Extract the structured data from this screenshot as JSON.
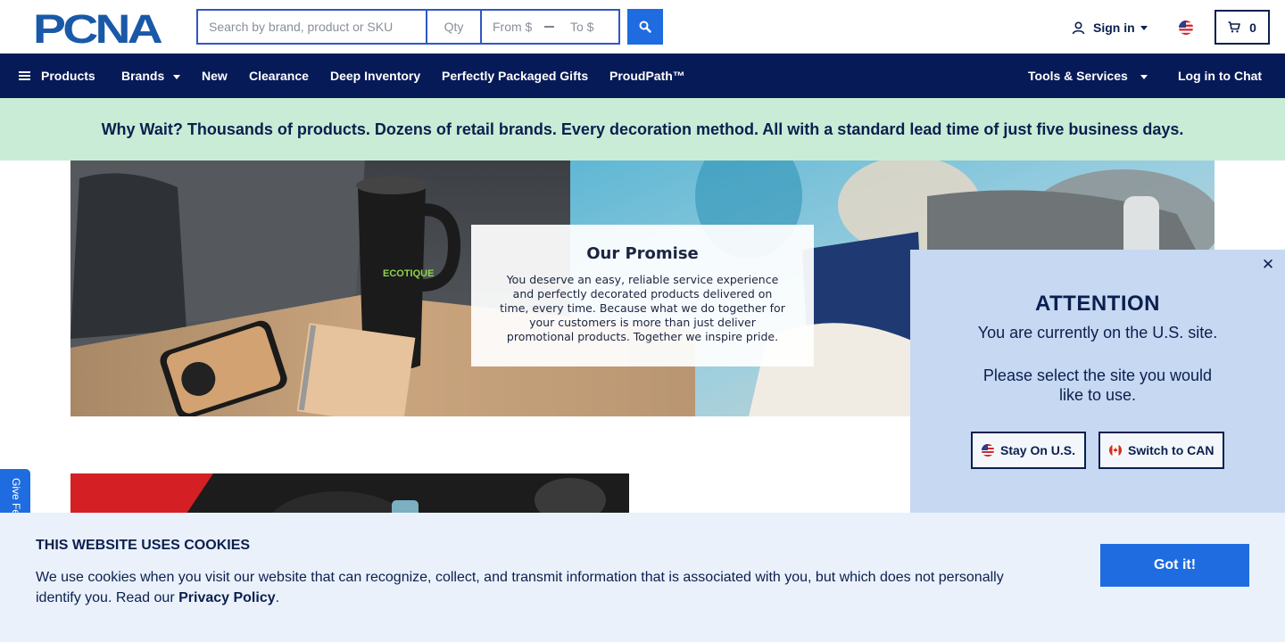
{
  "header": {
    "logo_text": "PCNA",
    "search": {
      "query_placeholder": "Search by brand, product or SKU",
      "qty_placeholder": "Qty",
      "price_from_placeholder": "From $",
      "price_to_placeholder": "To $"
    },
    "sign_in_label": "Sign in",
    "cart_count": "0"
  },
  "nav": {
    "items": [
      {
        "label": "Products"
      },
      {
        "label": "Brands"
      },
      {
        "label": "New"
      },
      {
        "label": "Clearance"
      },
      {
        "label": "Deep Inventory"
      },
      {
        "label": "Perfectly Packaged Gifts"
      },
      {
        "label": "ProudPath™"
      }
    ],
    "tools_label": "Tools & Services",
    "chat_label": "Log in to Chat"
  },
  "promo_text": "Why Wait? Thousands of products. Dozens of retail brands. Every decoration method. All with a standard lead time of just five business days.",
  "hero": {
    "title": "Our Promise",
    "body": "You deserve an easy, reliable service experience and perfectly decorated products delivered on time, every time. Because what we do together for your customers is more than just deliver promotional products. Together we inspire pride.",
    "brand_marks": [
      "ECOTIQUE"
    ]
  },
  "feedback_label": "Give Feedback",
  "attention": {
    "title": "ATTENTION",
    "line": "You are currently on the U.S. site.",
    "message": "Please select the site you would like to use.",
    "stay_label": "Stay On U.S.",
    "switch_label": "Switch to CAN"
  },
  "cookies": {
    "title": "THIS WEBSITE USES COOKIES",
    "text": "We use cookies when you visit our website that can recognize, collect, and transmit information that is associated with you, but which does not personally identify you. Read our ",
    "link_label": "Privacy Policy",
    "text_end": ".",
    "button_label": "Got it!"
  },
  "colors": {
    "navy": "#071a58",
    "accent_blue": "#1f6ce0",
    "promo_bg": "#c9ecd6",
    "modal_bg": "#c6d8f2",
    "cookie_bg": "#eaf1fb"
  }
}
